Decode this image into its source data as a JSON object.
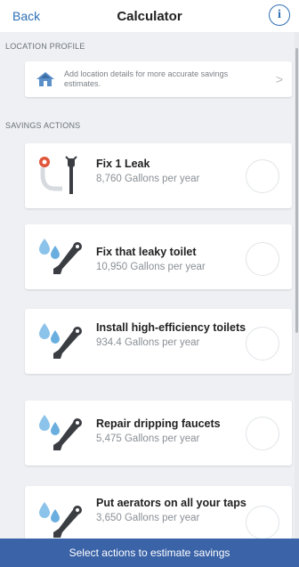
{
  "header": {
    "back_label": "Back",
    "title": "Calculator",
    "info_icon": "info-icon"
  },
  "location": {
    "section_label": "LOCATION PROFILE",
    "text": "Add location details for more accurate savings estimates.",
    "chevron": ">",
    "icon": "house-icon"
  },
  "savings": {
    "section_label": "SAVINGS ACTIONS",
    "actions": [
      {
        "name": "Fix 1 Leak",
        "sub": "8,760 Gallons per year",
        "icon": "pipe-leak-wrench-icon"
      },
      {
        "name": "Fix that leaky toilet",
        "sub": "10,950 Gallons per year",
        "icon": "water-drops-wrench-icon"
      },
      {
        "name": "Install high-efficiency toilets",
        "sub": "934.4 Gallons per year",
        "icon": "water-drops-wrench-icon"
      },
      {
        "name": "Repair dripping faucets",
        "sub": "5,475 Gallons per year",
        "icon": "water-drops-wrench-icon"
      },
      {
        "name": "Put aerators on all your taps",
        "sub": "3,650 Gallons per year",
        "icon": "water-drops-wrench-icon"
      }
    ]
  },
  "footer": {
    "label": "Select actions to estimate savings"
  },
  "colors": {
    "accent": "#2f6fb4",
    "footer_bg": "#3b63a8",
    "background": "#eef0f3"
  }
}
